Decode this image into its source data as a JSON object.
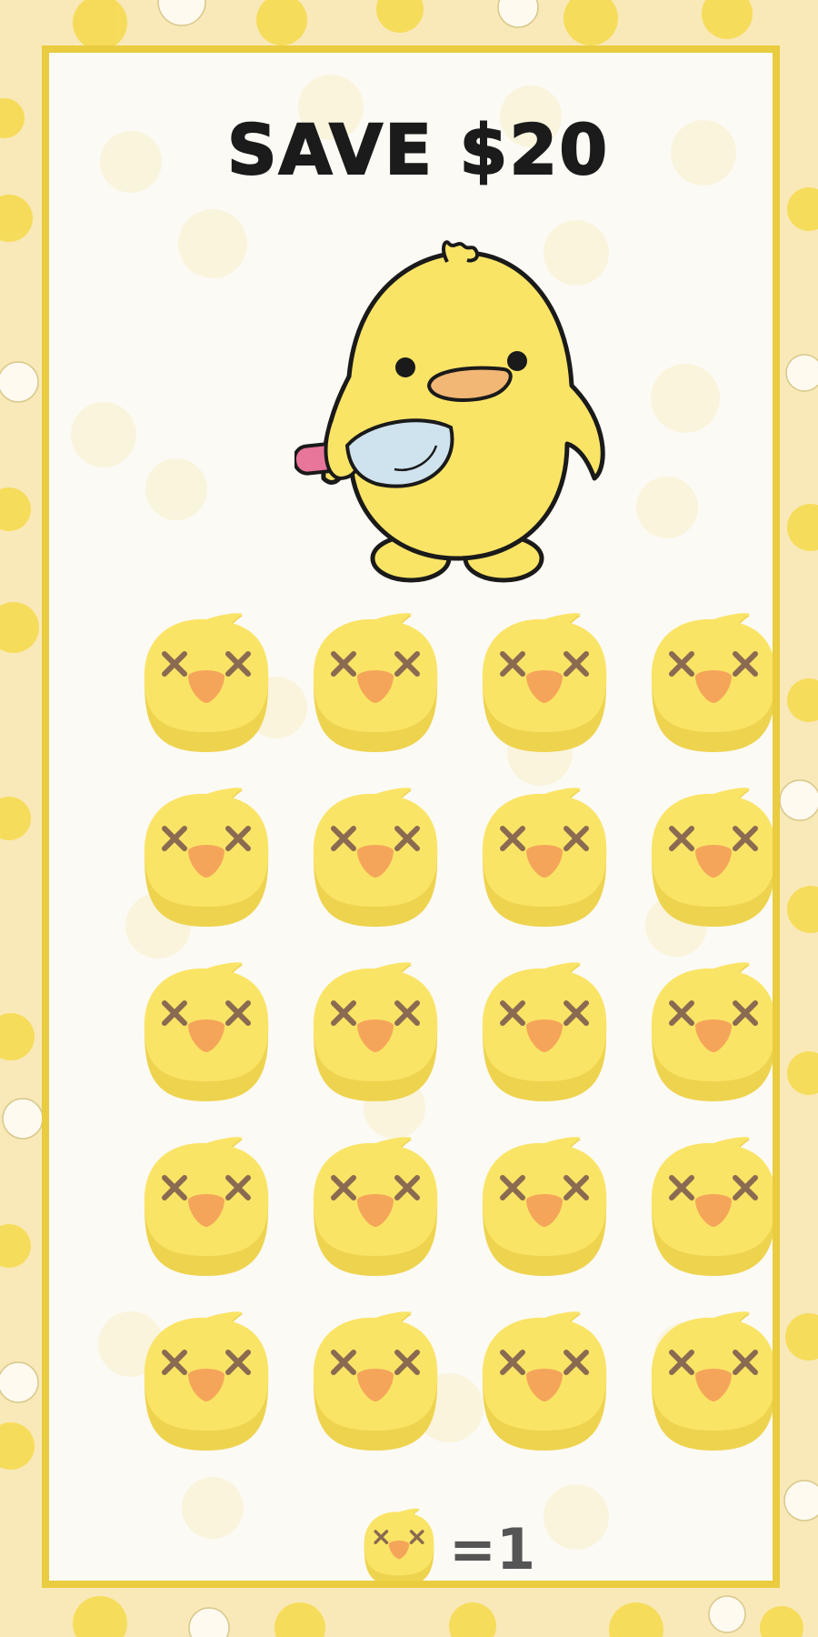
{
  "title": "SAVE $20",
  "mascot": {
    "icon": "chick-with-knife-icon"
  },
  "grid": {
    "rows": 5,
    "columns": 4,
    "cell_icon": "dead-chick-face-icon",
    "cell_count": 20
  },
  "legend": {
    "icon": "dead-chick-face-icon",
    "text": "=1"
  },
  "colors": {
    "background": "#f9e9b8",
    "border": "#e9cc3f",
    "card": "#fcfaf5",
    "chick_yellow": "#fae466",
    "chick_shadow": "#eed34e",
    "beak": "#f5a55a",
    "eye_x": "#8a6a50",
    "title": "#1b1b1b"
  }
}
